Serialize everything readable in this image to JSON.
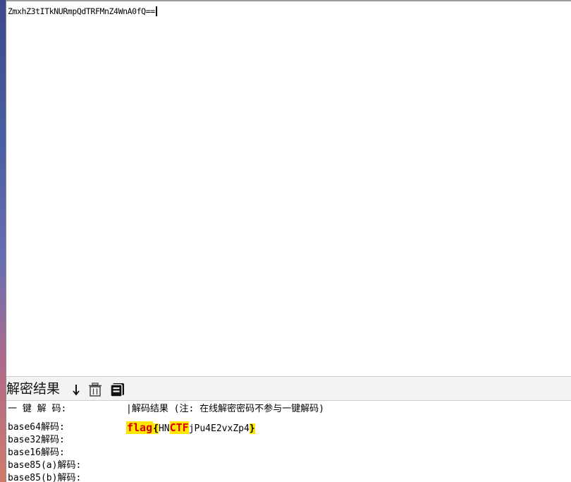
{
  "input": {
    "text": "ZmxhZ3tITkNURmpQdTRFMnZ4WnA0fQ=="
  },
  "toolbar": {
    "label": "解密结果",
    "icons": [
      "arrow-down-icon",
      "trash-icon",
      "copy-icon"
    ]
  },
  "results": {
    "header_name": "一 键 解 码:",
    "header_value": "|解码结果 (注: 在线解密密码不参与一键解码)",
    "rows": [
      {
        "name": "base64解码:",
        "value_parts": {
          "flag": "flag",
          "open_brace": "{",
          "hn": "HN",
          "ctf": "CTF",
          "rest": "jPu4E2vxZp4",
          "close_brace": "}"
        }
      },
      {
        "name": "base32解码:"
      },
      {
        "name": "base16解码:"
      },
      {
        "name": "base85(a)解码:"
      },
      {
        "name": "base85(b)解码:"
      }
    ]
  },
  "colors": {
    "highlight": "#ffe800",
    "flag_text": "#d40000",
    "toolbar_bg": "#f3f3f3"
  }
}
